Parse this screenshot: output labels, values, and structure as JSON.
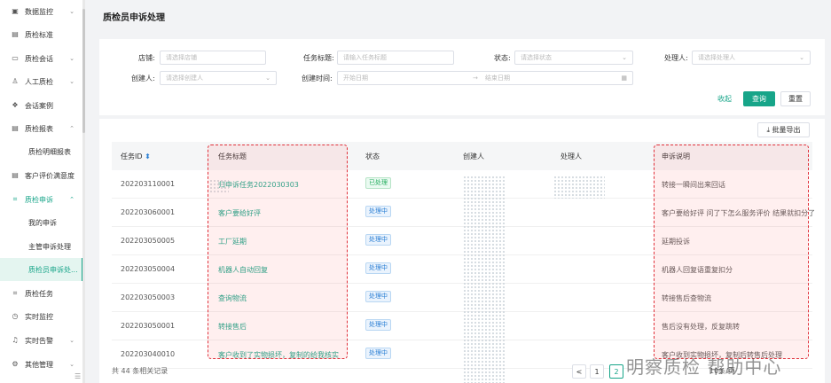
{
  "sidebar": {
    "items": [
      {
        "icon": "dashboard-icon",
        "glyph": "▣",
        "label": "数据监控",
        "arrow": "⌄"
      },
      {
        "icon": "doc-icon",
        "glyph": "▤",
        "label": "质检标准",
        "arrow": ""
      },
      {
        "icon": "chat-icon",
        "glyph": "▭",
        "label": "质检会话",
        "arrow": "⌄"
      },
      {
        "icon": "person-icon",
        "glyph": "♙",
        "label": "人工质检",
        "arrow": "⌄"
      },
      {
        "icon": "case-icon",
        "glyph": "❖",
        "label": "会话案例",
        "arrow": ""
      },
      {
        "icon": "report-icon",
        "glyph": "▤",
        "label": "质检报表",
        "arrow": "⌃"
      },
      {
        "icon": "",
        "glyph": "",
        "label": "质检明细报表",
        "arrow": "",
        "sub": true
      },
      {
        "icon": "rating-icon",
        "glyph": "▤",
        "label": "客户评价满意度",
        "arrow": ""
      },
      {
        "icon": "appeal-icon",
        "glyph": "⌗",
        "label": "质检申诉",
        "arrow": "⌃",
        "green": true
      },
      {
        "icon": "",
        "glyph": "",
        "label": "我的申诉",
        "arrow": "",
        "sub": true
      },
      {
        "icon": "",
        "glyph": "",
        "label": "主管申诉处理",
        "arrow": "",
        "sub": true
      },
      {
        "icon": "",
        "glyph": "",
        "label": "质检员申诉处...",
        "arrow": "",
        "sub": true,
        "active": true
      },
      {
        "icon": "task-icon",
        "glyph": "⌗",
        "label": "质检任务",
        "arrow": ""
      },
      {
        "icon": "clock-icon",
        "glyph": "◷",
        "label": "实时监控",
        "arrow": ""
      },
      {
        "icon": "bell-icon",
        "glyph": "♫",
        "label": "实时告警",
        "arrow": "⌄"
      },
      {
        "icon": "gear-icon",
        "glyph": "⚙",
        "label": "其他管理",
        "arrow": "⌄"
      }
    ]
  },
  "page": {
    "title": "质检员申诉处理"
  },
  "filters": {
    "store_label": "店铺:",
    "store_placeholder": "请选择店铺",
    "task_title_label": "任务标题:",
    "task_title_placeholder": "请输入任务标题",
    "status_label": "状态:",
    "status_placeholder": "请选择状态",
    "handler_label": "处理人:",
    "handler_placeholder": "请选择处理人",
    "creator_label": "创建人:",
    "creator_placeholder": "请选择创建人",
    "created_time_label": "创建时间:",
    "start_placeholder": "开始日期",
    "range_sep": "→",
    "end_placeholder": "结束日期"
  },
  "actions": {
    "collapse": "收起",
    "search": "查询",
    "reset": "重置",
    "export": "⤓ 批量导出"
  },
  "table": {
    "headers": {
      "id": "任务ID",
      "title": "任务标题",
      "status": "状态",
      "creator": "创建人",
      "handler": "处理人",
      "desc": "申诉说明"
    },
    "rows": [
      {
        "id": "202203110001",
        "title": "归申诉任务2022030303",
        "status": "已处理",
        "status_type": "done",
        "desc": "转接一瞬间出来回话"
      },
      {
        "id": "202203060001",
        "title": "客户要给好评",
        "status": "处理中",
        "status_type": "doing",
        "desc": "客户要给好评 问了下怎么服务评价 结果就扣分了"
      },
      {
        "id": "202203050005",
        "title": "工厂延期",
        "status": "处理中",
        "status_type": "doing",
        "desc": "延期投诉"
      },
      {
        "id": "202203050004",
        "title": "机器人自动回复",
        "status": "处理中",
        "status_type": "doing",
        "desc": "机器人回复语重复扣分"
      },
      {
        "id": "202203050003",
        "title": "查询物流",
        "status": "处理中",
        "status_type": "doing",
        "desc": "转接售后查物流"
      },
      {
        "id": "202203050001",
        "title": "转接售后",
        "status": "处理中",
        "status_type": "doing",
        "desc": "售后没有处理，反复跳转"
      },
      {
        "id": "202203040010",
        "title": "客户收到了实物损坏，复制的给我核实",
        "status": "处理中",
        "status_type": "doing",
        "desc": "客户收到实物损坏，复制后转售后处理"
      }
    ]
  },
  "footer": {
    "total": "共 44 条相关记录",
    "prev": "<",
    "page1": "1",
    "page2": "2",
    "pagesize": "10条/页"
  },
  "watermark": "明察质检 帮助中心",
  "colors": {
    "accent": "#17a589",
    "highlight": "#e0303a"
  }
}
